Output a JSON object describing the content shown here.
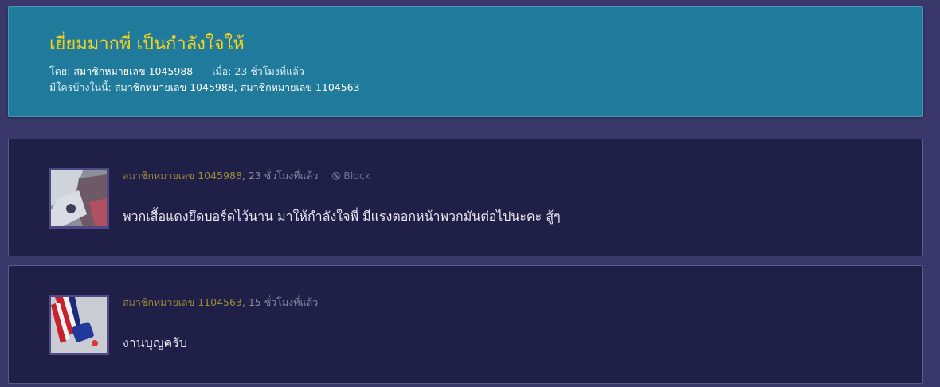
{
  "topic": {
    "title": "เยี่ยมมากพี่ เป็นกำลังใจให้",
    "by_label": "โดย:",
    "author": "สมาชิกหมายเลข 1045988",
    "when_label": "เมื่อ:",
    "when_value": "23 ชั่วโมงที่แล้ว",
    "participants_label": "มีใครบ้างในนี้:",
    "participants": "สมาชิกหมายเลข 1045988, สมาชิกหมายเลข 1104563"
  },
  "replies": [
    {
      "author": "สมาชิกหมายเลข 1045988",
      "time": ", 23 ชั่วโมงที่แล้ว",
      "block_label": "Block",
      "body": "พวกเสื้อแดงยึดบอร์ดไว้นาน มาให้กำลังใจพี่ มีแรงตอกหน้าพวกมันต่อไปนะคะ สู้ๆ"
    },
    {
      "author": "สมาชิกหมายเลข 1104563",
      "time": ", 15 ชั่วโมงที่แล้ว",
      "body": "งานบุญครับ"
    }
  ],
  "colors": {
    "page_bg": "#3a376b",
    "header_bg": "#1f7a9c",
    "title": "#f3d21c",
    "reply_bg": "#201f47",
    "author": "#9b8a3a"
  }
}
